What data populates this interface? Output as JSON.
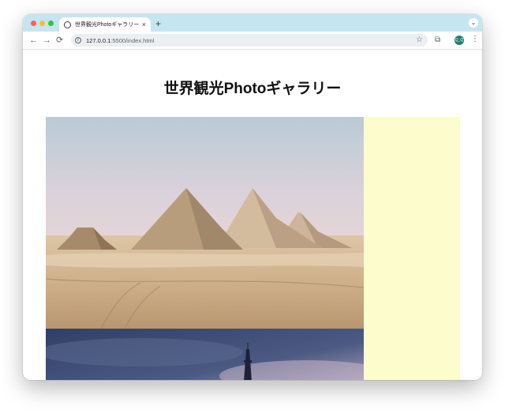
{
  "browser": {
    "tab": {
      "title": "世界観光Photoギャラリー",
      "favicon": "globe-icon",
      "close": "×"
    },
    "new_tab": "+",
    "tab_search": "⌄",
    "nav": {
      "back": "←",
      "forward": "→",
      "reload": "⟳"
    },
    "omnibox": {
      "info": "i",
      "url_host": "127.0.0.1",
      "url_rest": ":5500/index.html"
    },
    "bookmark": "☆",
    "extensions": "⧉",
    "profile": "Q_Q",
    "menu": "⋮"
  },
  "page": {
    "heading": "世界観光Photoギャラリー",
    "photos": [
      {
        "subject": "pyramids-of-giza"
      },
      {
        "subject": "eiffel-tower"
      }
    ],
    "sidebar_color": "#fdfccd"
  }
}
